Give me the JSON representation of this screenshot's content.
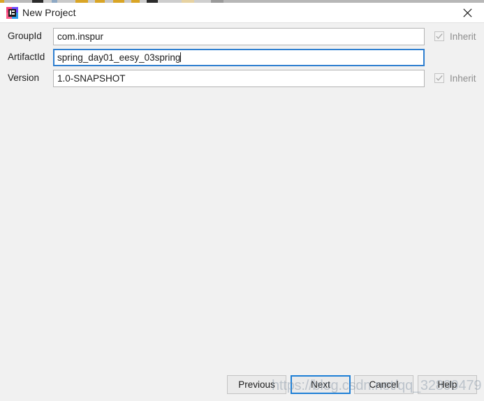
{
  "window": {
    "title": "New Project",
    "icon": "intellij-idea-icon",
    "close_label": "×"
  },
  "form": {
    "rows": [
      {
        "label": "GroupId",
        "value": "com.inspur",
        "placeholder": "",
        "focused": false,
        "inherit": {
          "label": "Inherit",
          "checked": true,
          "enabled": false,
          "visible": true
        }
      },
      {
        "label": "ArtifactId",
        "value": "spring_day01_eesy_03spring",
        "placeholder": "",
        "focused": true,
        "inherit": {
          "label": "Inherit",
          "checked": false,
          "enabled": false,
          "visible": false
        }
      },
      {
        "label": "Version",
        "value": "1.0-SNAPSHOT",
        "placeholder": "",
        "focused": false,
        "inherit": {
          "label": "Inherit",
          "checked": true,
          "enabled": false,
          "visible": true
        }
      }
    ]
  },
  "buttons": {
    "previous": "Previous",
    "next": "Next",
    "cancel": "Cancel",
    "help": "Help",
    "default_button": "Next"
  },
  "watermark": {
    "text": "https://blog.csdn.net/qq_32899479"
  },
  "colors": {
    "accent": "#1d7fd6",
    "focus_border": "#2f7fd0",
    "dialog_background": "#f1f1f1",
    "titlebar_background": "#ffffff",
    "field_background": "#ffffff",
    "field_border": "#b4b4b4",
    "button_background": "#eaeaea",
    "disabled_text": "#8d8d8d",
    "text": "#1b1b1b"
  }
}
